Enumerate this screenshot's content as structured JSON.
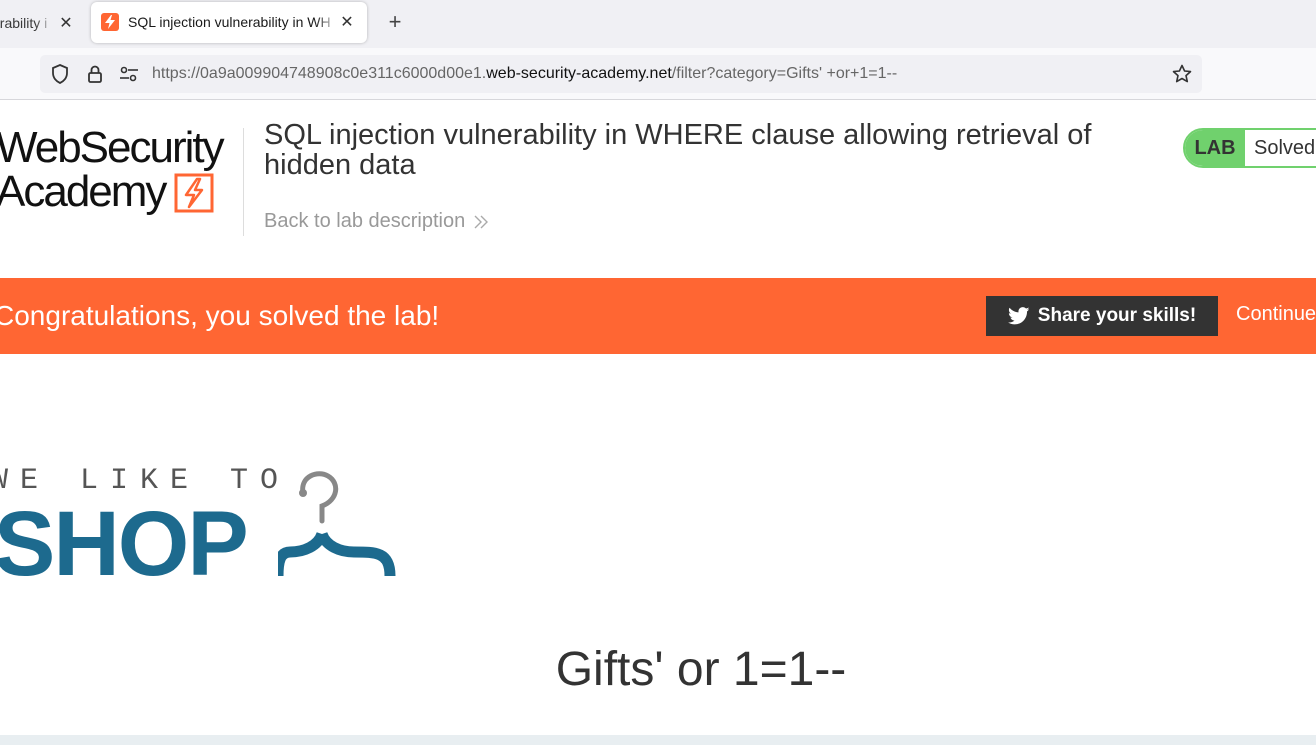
{
  "browser": {
    "tabs": [
      {
        "title": "Lab: SQL injection vulnerability in WHERE clause",
        "visible_title": "erability i",
        "active": false
      },
      {
        "title": "SQL injection vulnerability in WHERE clause allowing retrieval of hidden data",
        "visible_title": "SQL injection vulnerability in WH",
        "active": true
      }
    ],
    "new_tab_symbol": "+",
    "close_symbol": "✕",
    "url": {
      "prefix": "https://0a9a009904748908c0e311c6000d00e1.",
      "host": "web-security-academy.net",
      "path": "/filter?category=Gifts' +or+1=1--"
    },
    "icons": [
      "shield-icon",
      "lock-icon",
      "permissions-icon",
      "bookmark-star-icon"
    ]
  },
  "academy": {
    "logo_line1": "WebSecurity",
    "logo_line2": "Academy"
  },
  "lab": {
    "title": "SQL injection vulnerability in WHERE clause allowing retrieval of hidden data",
    "back_link": "Back to lab description",
    "badge_label": "LAB",
    "status": "Solved"
  },
  "banner": {
    "message": "Congratulations, you solved the lab!",
    "share_button": "Share your skills!",
    "continue_link": "Continue"
  },
  "shop": {
    "tagline": "WE LIKE TO",
    "word": "SHOP"
  },
  "page": {
    "heading": "Gifts' or 1=1--"
  },
  "colors": {
    "brand_orange": "#ff6633",
    "solved_green": "#70d16d",
    "shop_blue": "#1d6a8e",
    "button_dark": "#333333"
  }
}
